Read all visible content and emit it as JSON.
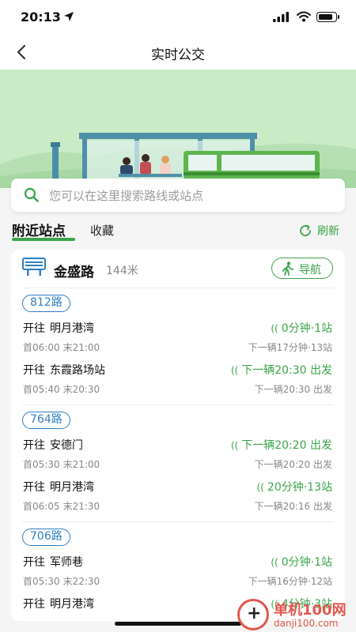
{
  "status_bar": {
    "time": "20:13"
  },
  "nav": {
    "title": "实时公交"
  },
  "search": {
    "placeholder": "您可以在这里搜索路线或站点"
  },
  "tabs": {
    "nearby": "附近站点",
    "favorites": "收藏",
    "refresh": "刷新"
  },
  "stop": {
    "name": "金盛路",
    "distance": "144米",
    "nav_button": "导航"
  },
  "routes": [
    {
      "label": "812路",
      "directions": [
        {
          "prefix": "开往",
          "dest": "明月港湾",
          "first": "首06:00",
          "last": "末21:00",
          "realtime": "0分钟·1站",
          "next": "下一辆17分钟·13站"
        },
        {
          "prefix": "开往",
          "dest": "东霞路场站",
          "first": "首05:40",
          "last": "末20:30",
          "realtime": "下一辆20:30 出发",
          "next": "下一辆20:30 出发"
        }
      ]
    },
    {
      "label": "764路",
      "directions": [
        {
          "prefix": "开往",
          "dest": "安德门",
          "first": "首05:30",
          "last": "末21:00",
          "realtime": "下一辆20:20 出发",
          "next": "下一辆20:20 出发"
        },
        {
          "prefix": "开往",
          "dest": "明月港湾",
          "first": "首06:05",
          "last": "末21:30",
          "realtime": "20分钟·13站",
          "next": "下一辆20:16 出发"
        }
      ]
    },
    {
      "label": "706路",
      "directions": [
        {
          "prefix": "开往",
          "dest": "军师巷",
          "first": "首05:30",
          "last": "末22:30",
          "realtime": "0分钟·1站",
          "next": "下一辆16分钟·12站"
        },
        {
          "prefix": "开往",
          "dest": "明月港湾",
          "first": "",
          "last": "",
          "realtime": "4分钟·3站",
          "next": ""
        }
      ]
    }
  ],
  "watermark": {
    "brand": "单机100网",
    "url": "danji100.com"
  },
  "colors": {
    "accent": "#3aa54a",
    "route_badge": "#2f7fc1",
    "banner_bg": "#c9ecc7"
  }
}
